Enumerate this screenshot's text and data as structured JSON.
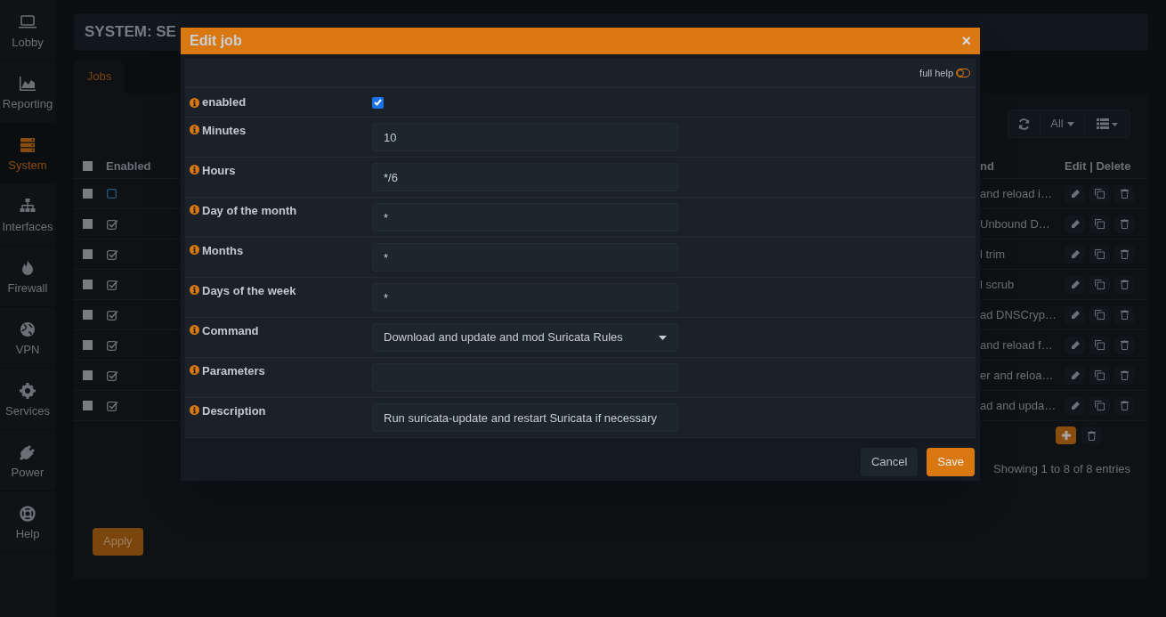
{
  "sidebar": {
    "items": [
      {
        "label": "Lobby",
        "selected": false
      },
      {
        "label": "Reporting",
        "selected": false
      },
      {
        "label": "System",
        "selected": true
      },
      {
        "label": "Interfaces",
        "selected": false
      },
      {
        "label": "Firewall",
        "selected": false
      },
      {
        "label": "VPN",
        "selected": false
      },
      {
        "label": "Services",
        "selected": false
      },
      {
        "label": "Power",
        "selected": false
      },
      {
        "label": "Help",
        "selected": false
      }
    ]
  },
  "page": {
    "title": "SYSTEM: SE",
    "tabs": [
      {
        "label": "Jobs",
        "selected": true
      }
    ],
    "toolbar": {
      "filter": "All"
    },
    "table": {
      "select_all": {
        "checked": false
      },
      "columns": [
        "Enabled",
        "nd",
        "Edit | Delete"
      ],
      "rows": [
        {
          "selected": false,
          "enabled": false,
          "command": "and reload i…"
        },
        {
          "selected": false,
          "enabled": true,
          "command": "Unbound D…"
        },
        {
          "selected": false,
          "enabled": true,
          "command": "l trim"
        },
        {
          "selected": false,
          "enabled": true,
          "command": "l scrub"
        },
        {
          "selected": false,
          "enabled": true,
          "command": "ad DNSCryp…"
        },
        {
          "selected": false,
          "enabled": true,
          "command": "and reload f…"
        },
        {
          "selected": false,
          "enabled": true,
          "command": "er and reloa…"
        },
        {
          "selected": false,
          "enabled": true,
          "command": "ad and upda…"
        }
      ]
    },
    "footer": "Showing 1 to 8 of 8 entries",
    "apply": "Apply"
  },
  "dialog": {
    "title": "Edit job",
    "close": "×",
    "full_help": {
      "label": "full help",
      "on": false
    },
    "fields": [
      {
        "kind": "checkbox",
        "label": "enabled",
        "checked": true
      },
      {
        "kind": "text",
        "label": "Minutes",
        "value": "10"
      },
      {
        "kind": "text",
        "label": "Hours",
        "value": "*/6"
      },
      {
        "kind": "text",
        "label": "Day of the month",
        "value": "*"
      },
      {
        "kind": "text",
        "label": "Months",
        "value": "*"
      },
      {
        "kind": "text",
        "label": "Days of the week",
        "value": "*"
      },
      {
        "kind": "select",
        "label": "Command",
        "value": "Download and update and mod Suricata Rules"
      },
      {
        "kind": "text",
        "label": "Parameters"
      },
      {
        "kind": "text",
        "label": "Description",
        "value": "Run suricata-update and restart Suricata if necessary"
      }
    ],
    "buttons": [
      {
        "label": "Cancel",
        "kind": "secondary"
      },
      {
        "label": "Save",
        "kind": "primary"
      }
    ]
  }
}
